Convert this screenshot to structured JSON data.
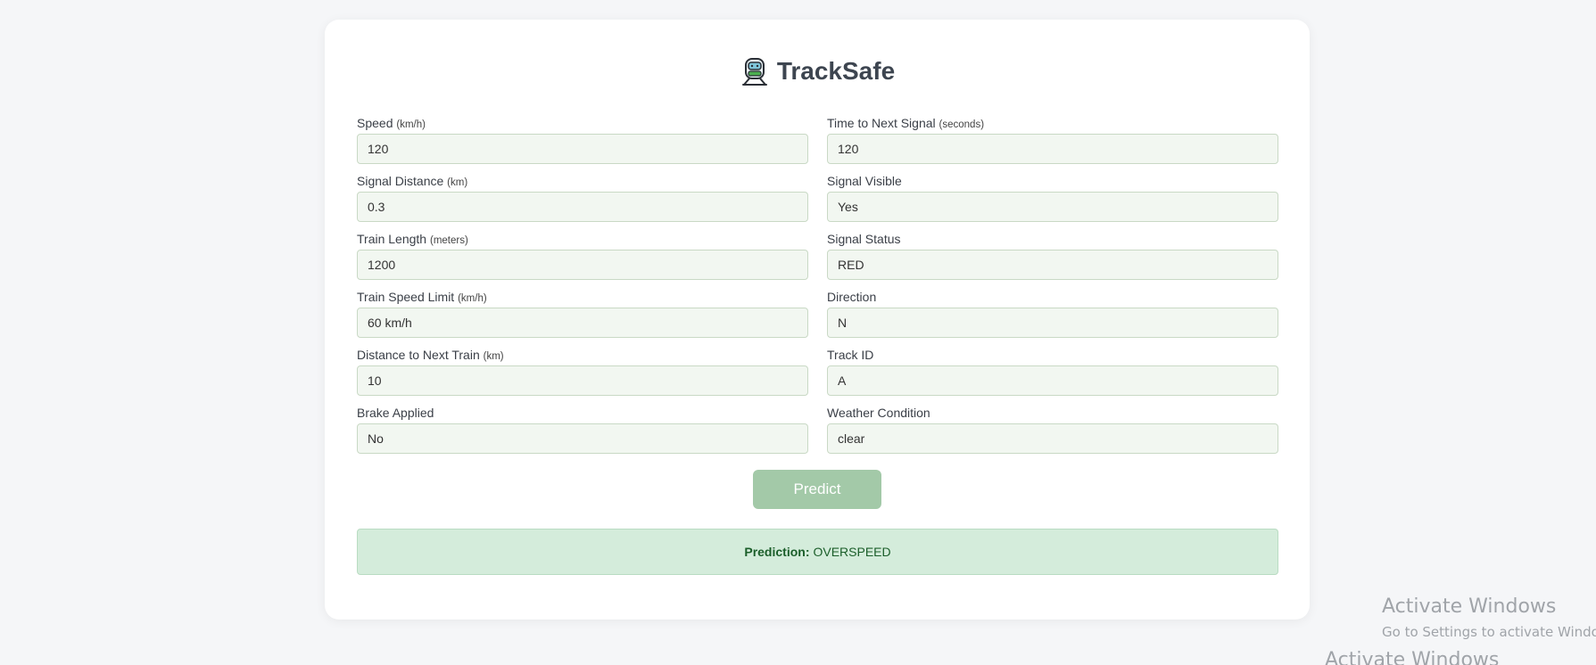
{
  "app": {
    "title": "TrackSafe"
  },
  "form": {
    "fields": [
      {
        "label": "Speed",
        "unit": "(km/h)",
        "value": "120"
      },
      {
        "label": "Time to Next Signal",
        "unit": "(seconds)",
        "value": "120"
      },
      {
        "label": "Signal Distance",
        "unit": "(km)",
        "value": "0.3"
      },
      {
        "label": "Signal Visible",
        "unit": "",
        "value": "Yes"
      },
      {
        "label": "Train Length",
        "unit": "(meters)",
        "value": "1200"
      },
      {
        "label": "Signal Status",
        "unit": "",
        "value": "RED"
      },
      {
        "label": "Train Speed Limit",
        "unit": "(km/h)",
        "value": "60 km/h"
      },
      {
        "label": "Direction",
        "unit": "",
        "value": "N"
      },
      {
        "label": "Distance to Next Train",
        "unit": "(km)",
        "value": "10"
      },
      {
        "label": "Track ID",
        "unit": "",
        "value": "A"
      },
      {
        "label": "Brake Applied",
        "unit": "",
        "value": "No"
      },
      {
        "label": "Weather Condition",
        "unit": "",
        "value": "clear"
      }
    ],
    "predict_label": "Predict"
  },
  "result": {
    "label": "Prediction:",
    "value": "OVERSPEED"
  },
  "watermark": {
    "title": "Activate Windows",
    "subtitle": "Go to Settings to activate Windows.",
    "title_repeat": "Activate Windows"
  },
  "colors": {
    "accent": "#a3c9a8",
    "result_bg": "#d4ecdb",
    "result_text": "#1b5e2a",
    "input_bg": "#f2f7f1"
  },
  "icons": {
    "logo": "train-icon"
  }
}
